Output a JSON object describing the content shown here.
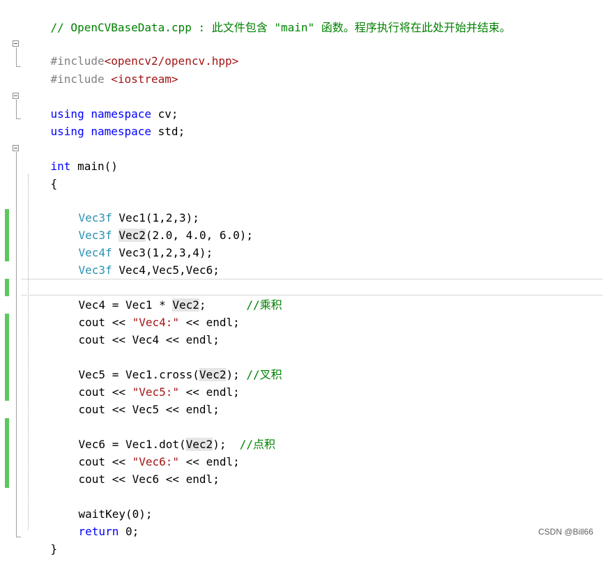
{
  "code": {
    "comment_header": "// OpenCVBaseData.cpp : 此文件包含 \"main\" 函数。程序执行将在此处开始并结束。",
    "include1_directive": "#include",
    "include1_file": "<opencv2/opencv.hpp>",
    "include2_directive": "#include ",
    "include2_file": "<iostream>",
    "using1_kw": "using namespace",
    "using1_ns": " cv;",
    "using2_kw": "using namespace",
    "using2_ns": " std;",
    "main_type": "int",
    "main_sig": " main()",
    "brace_open": "{",
    "decl1_type": "Vec3f",
    "decl1_rest": " Vec1(1,2,3);",
    "decl2_type": "Vec3f",
    "decl2_name": "Vec2",
    "decl2_rest": "(2.0, 4.0, 6.0);",
    "decl3_type": "Vec4f",
    "decl3_rest": " Vec3(1,2,3,4);",
    "decl4_type": "Vec3f",
    "decl4_rest": " Vec4,Vec5,Vec6;",
    "mul_lhs": "Vec4 = Vec1 * ",
    "mul_ref": "Vec2",
    "mul_end": ";      ",
    "mul_comment": "//乘积",
    "cout1_a": "cout << ",
    "cout1_str": "\"Vec4:\"",
    "cout1_b": " << endl;",
    "cout2": "cout << Vec4 << endl;",
    "cross_lhs": "Vec5 = Vec1.cross(",
    "cross_ref": "Vec2",
    "cross_end": "); ",
    "cross_comment": "//叉积",
    "cout3_a": "cout << ",
    "cout3_str": "\"Vec5:\"",
    "cout3_b": " << endl;",
    "cout4": "cout << Vec5 << endl;",
    "dot_lhs": "Vec6 = Vec1.dot(",
    "dot_ref": "Vec2",
    "dot_end": ");  ",
    "dot_comment": "//点积",
    "cout5_a": "cout << ",
    "cout5_str": "\"Vec6:\"",
    "cout5_b": " << endl;",
    "cout6": "cout << Vec6 << endl;",
    "wait": "waitKey(0);",
    "ret_kw": "return",
    "ret_val": " 0;",
    "brace_close": "}"
  },
  "watermark": "CSDN @Bill66",
  "colors": {
    "keyword": "#0000ff",
    "type": "#2b91af",
    "string": "#a31515",
    "comment": "#008000",
    "preprocessor": "#808080",
    "change_bar": "#5cc85c"
  }
}
